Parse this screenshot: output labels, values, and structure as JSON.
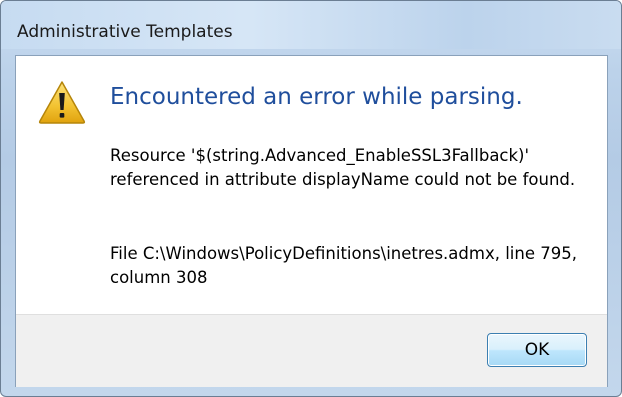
{
  "window": {
    "title": "Administrative Templates"
  },
  "dialog": {
    "icon": "warning-icon",
    "main_instruction": "Encountered an error while parsing.",
    "message": "Resource '$(string.Advanced_EnableSSL3Fallback)' referenced in attribute displayName could not be found.",
    "file_info": "File C:\\Windows\\PolicyDefinitions\\inetres.admx, line 795, column 308"
  },
  "buttons": {
    "ok_label": "OK"
  },
  "colors": {
    "instruction": "#1f4e9c",
    "warning_yellow": "#f2c230",
    "button_border": "#3c7fb1"
  }
}
